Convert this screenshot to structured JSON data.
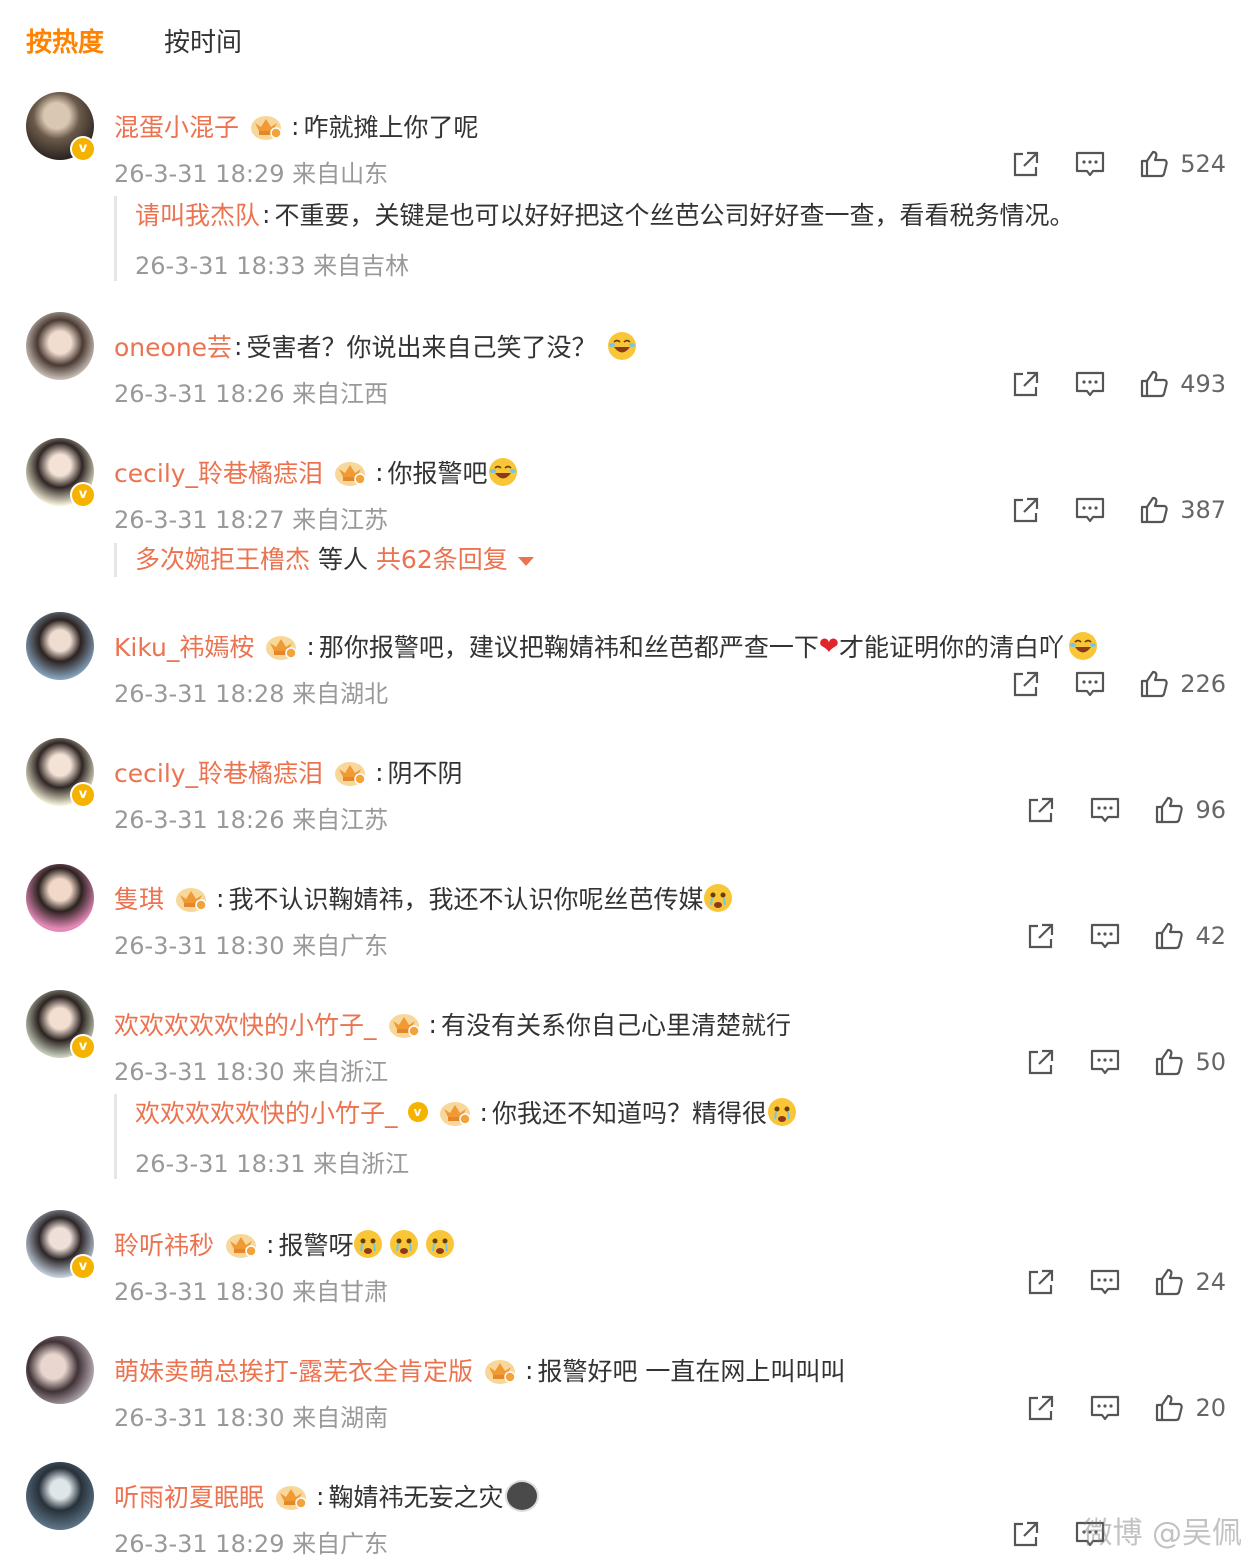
{
  "tabs": {
    "hot": "按热度",
    "time": "按时间"
  },
  "comments": [
    {
      "user": "混蛋小混子",
      "text": "咋就摊上你了呢",
      "meta": "26-3-31 18:29 来自山东",
      "likes": "524",
      "reply": {
        "user": "请叫我杰队",
        "text": "不重要，关键是也可以好好把这个丝芭公司好好查一查，看看税务情况。",
        "meta": "26-3-31 18:33 来自吉林"
      }
    },
    {
      "user": "oneone芸",
      "text": "受害者？你说出来自己笑了没？",
      "meta": "26-3-31 18:26 来自江西",
      "likes": "493"
    },
    {
      "user": "cecily_聆巷橘痣泪",
      "text": "你报警吧",
      "meta": "26-3-31 18:27 来自江苏",
      "likes": "387"
    },
    {
      "user": "Kiku_祎嫣桉",
      "text": "那你报警吧，建议把鞠婧祎和丝芭都严查一下",
      "text2": "才能证明你的清白吖",
      "meta": "26-3-31 18:28 来自湖北",
      "likes": "226"
    },
    {
      "user": "cecily_聆巷橘痣泪",
      "text": "阴不阴",
      "meta": "26-3-31 18:26 来自江苏",
      "likes": "96"
    },
    {
      "user": "隻琪",
      "text": "我不认识鞠婧祎，我还不认识你呢丝芭传媒",
      "meta": "26-3-31 18:30 来自广东",
      "likes": "42"
    },
    {
      "user": "欢欢欢欢欢快的小竹子_",
      "text": "有没有关系你自己心里清楚就行",
      "meta": "26-3-31 18:30 来自浙江",
      "likes": "50",
      "reply": {
        "user": "欢欢欢欢欢快的小竹子_",
        "text": "你我还不知道吗？精得很",
        "meta": "26-3-31 18:31 来自浙江"
      }
    },
    {
      "user": "聆听祎秒",
      "text": "报警呀",
      "meta": "26-3-31 18:30 来自甘肃",
      "likes": "24"
    },
    {
      "user": "萌妹卖萌总挨打-露芜衣全肯定版",
      "text": "报警好吧 一直在网上叫叫叫",
      "meta": "26-3-31 18:30 来自湖南",
      "likes": "20"
    },
    {
      "user": "听雨初夏眠眠",
      "text": "鞠婧祎无妄之灾",
      "meta": "26-3-31 18:29 来自广东",
      "likes": ""
    }
  ],
  "more_replies": {
    "user": "多次婉拒王橹杰",
    "mid": " 等人 ",
    "count": "共62条回复"
  },
  "colon": ":",
  "watermark": "微博 @吴佩",
  "colors": {
    "accent": "#ff8200",
    "username": "#eb7350",
    "meta": "#999999"
  },
  "icons": [
    "share-icon",
    "comment-icon",
    "like-icon",
    "crown-badge-icon",
    "verified-badge-icon"
  ]
}
